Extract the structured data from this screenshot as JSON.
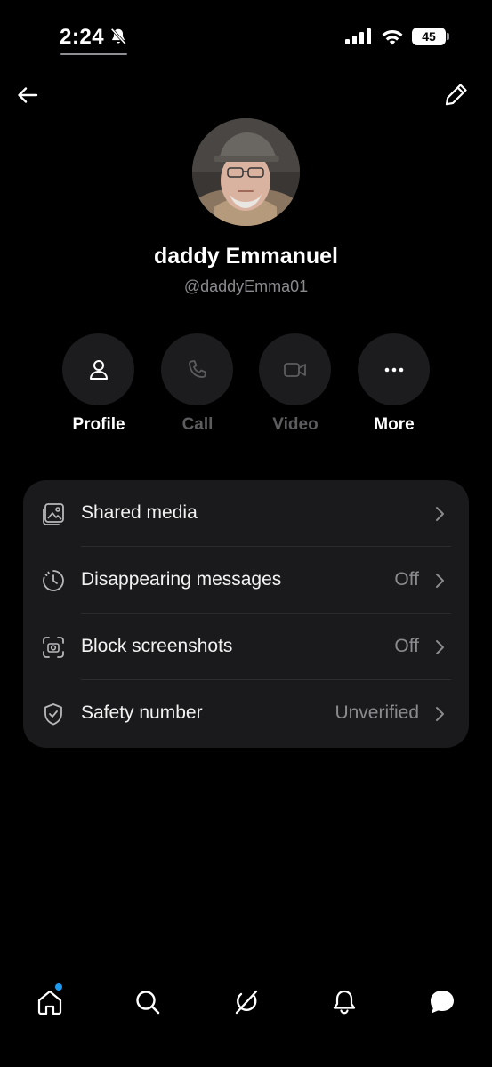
{
  "status_bar": {
    "time": "2:24",
    "battery": "45"
  },
  "contact": {
    "name": "daddy Emmanuel",
    "handle": "@daddyEmma01"
  },
  "actions": [
    {
      "label": "Profile",
      "enabled": true,
      "icon": "person-icon"
    },
    {
      "label": "Call",
      "enabled": false,
      "icon": "phone-icon"
    },
    {
      "label": "Video",
      "enabled": false,
      "icon": "video-icon"
    },
    {
      "label": "More",
      "enabled": true,
      "icon": "ellipsis-icon"
    }
  ],
  "settings": [
    {
      "label": "Shared media",
      "value": "",
      "icon": "media-gallery-icon"
    },
    {
      "label": "Disappearing messages",
      "value": "Off",
      "icon": "timer-icon"
    },
    {
      "label": "Block screenshots",
      "value": "Off",
      "icon": "screenshot-camera-icon"
    },
    {
      "label": "Safety number",
      "value": "Unverified",
      "icon": "shield-check-icon"
    }
  ],
  "bottom_nav": [
    {
      "name": "home",
      "icon": "home-icon",
      "has_notification_dot": true
    },
    {
      "name": "search",
      "icon": "search-icon"
    },
    {
      "name": "grok",
      "icon": "grok-icon"
    },
    {
      "name": "notifications",
      "icon": "bell-icon"
    },
    {
      "name": "messages",
      "icon": "message-bubble-icon",
      "active": true
    }
  ],
  "colors": {
    "background": "#000000",
    "card": "#1a1a1c",
    "button_circle": "#1c1c1e",
    "muted_text": "#8b8b8f",
    "disabled_text": "#5c5c5f",
    "accent_dot": "#1d9bf0"
  }
}
